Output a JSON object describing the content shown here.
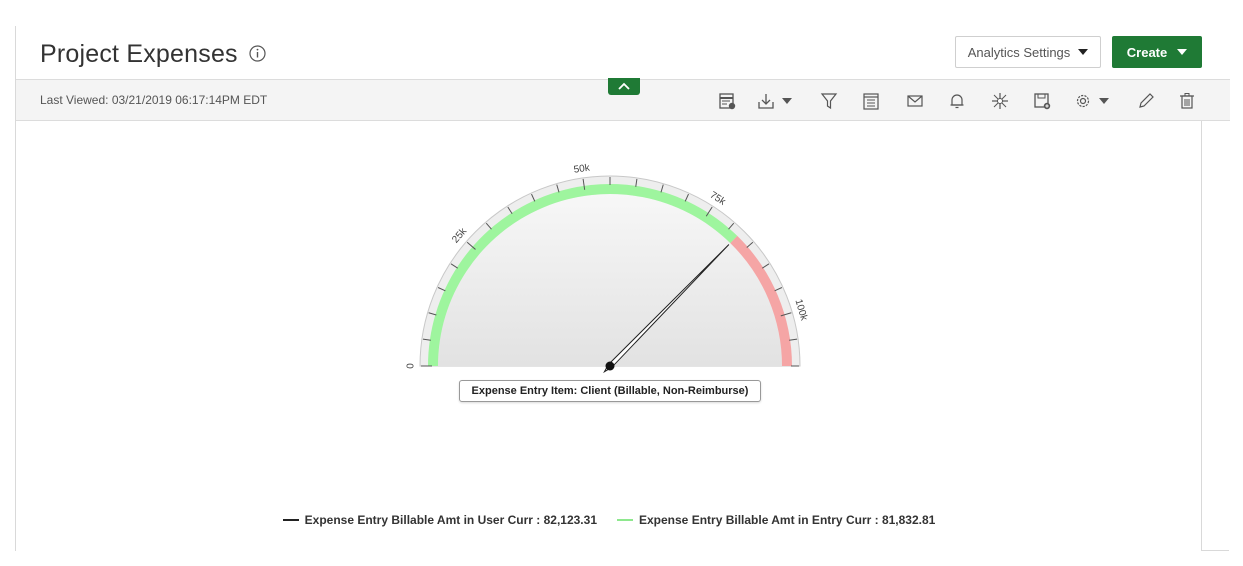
{
  "header": {
    "title": "Project Expenses",
    "analytics_settings_label": "Analytics Settings",
    "create_label": "Create"
  },
  "toolbar": {
    "last_viewed": "Last Viewed: 03/21/2019 06:17:14PM EDT",
    "icons": [
      "table-icon",
      "download-icon",
      "filter-icon",
      "notes-icon",
      "email-icon",
      "bell-icon",
      "network-icon",
      "save-icon",
      "gear-icon",
      "edit-icon",
      "trash-icon"
    ]
  },
  "colors": {
    "brand_green": "#1f7a35",
    "band_green": "#9ef59e",
    "band_red": "#f5a5a5",
    "needle_black": "#222222",
    "legend_green": "#8ee88e"
  },
  "chart_data": {
    "type": "gauge",
    "min": 0,
    "max": 110000,
    "tick_labels": [
      "0",
      "25k",
      "50k",
      "75k",
      "100k"
    ],
    "bands": [
      {
        "from": 0,
        "to": 82123.31,
        "color": "#9ef59e"
      },
      {
        "from": 82123.31,
        "to": 110000,
        "color": "#f5a5a5"
      }
    ],
    "needle_value": 82123.31,
    "data_label": "Expense Entry Item: Client (Billable, Non-Reimburse)",
    "series": [
      {
        "name": "Expense Entry Billable Amt in User Curr : 82,123.31",
        "value": 82123.31,
        "color": "#222222"
      },
      {
        "name": "Expense Entry Billable Amt in Entry Curr : 81,832.81",
        "value": 81832.81,
        "color": "#8ee88e"
      }
    ]
  }
}
